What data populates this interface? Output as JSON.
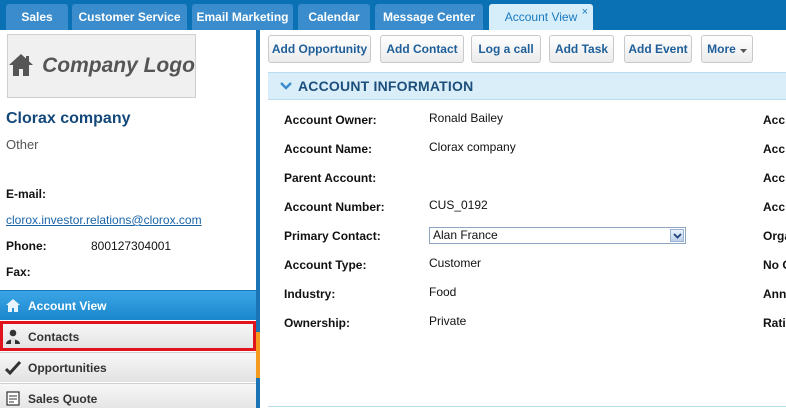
{
  "tabs": [
    {
      "label": "Sales"
    },
    {
      "label": "Customer Service"
    },
    {
      "label": "Email Marketing"
    },
    {
      "label": "Calendar"
    },
    {
      "label": "Message Center"
    },
    {
      "label": "Account View",
      "active": true
    }
  ],
  "tab_close_glyph": "×",
  "sidebar": {
    "logo_text": "Company Logo",
    "logo_icon": "home-icon",
    "company_name": "Clorax company",
    "company_type": "Other",
    "email_label": "E-mail:",
    "email_value": "clorox.investor.relations@clorox.com",
    "phone_label": "Phone:",
    "phone_value": "800127304001",
    "fax_label": "Fax:",
    "nav": [
      {
        "label": "Account View",
        "icon": "home-icon",
        "active": true
      },
      {
        "label": "Contacts",
        "icon": "contacts-icon",
        "highlighted": true
      },
      {
        "label": "Opportunities",
        "icon": "checkmark-icon"
      },
      {
        "label": "Sales Quote",
        "icon": "quote-icon"
      }
    ]
  },
  "toolbar": {
    "add_opportunity": "Add Opportunity",
    "add_contact": "Add Contact",
    "log_call": "Log a call",
    "add_task": "Add Task",
    "add_event": "Add Event",
    "more": "More"
  },
  "account_info": {
    "title": "ACCOUNT INFORMATION",
    "fields": [
      {
        "label": "Account Owner:",
        "value": "Ronald Bailey"
      },
      {
        "label": "Account Name:",
        "value": "Clorax company"
      },
      {
        "label": "Parent Account:",
        "value": ""
      },
      {
        "label": "Account Number:",
        "value": "CUS_0192"
      },
      {
        "label": "Primary Contact:",
        "value": "Alan France"
      },
      {
        "label": "Account Type:",
        "value": "Customer"
      },
      {
        "label": "Industry:",
        "value": "Food"
      },
      {
        "label": "Ownership:",
        "value": "Private"
      }
    ],
    "right_labels": [
      "Acc",
      "Acc",
      "Acc",
      "Acc",
      "Orga",
      "No C",
      "Annu",
      "Rati"
    ]
  },
  "colors": {
    "tabbar": "#0a71b4",
    "active_nav": "#1a86cc",
    "highlight_border": "#e0141d",
    "section_header": "#d9eef9"
  }
}
